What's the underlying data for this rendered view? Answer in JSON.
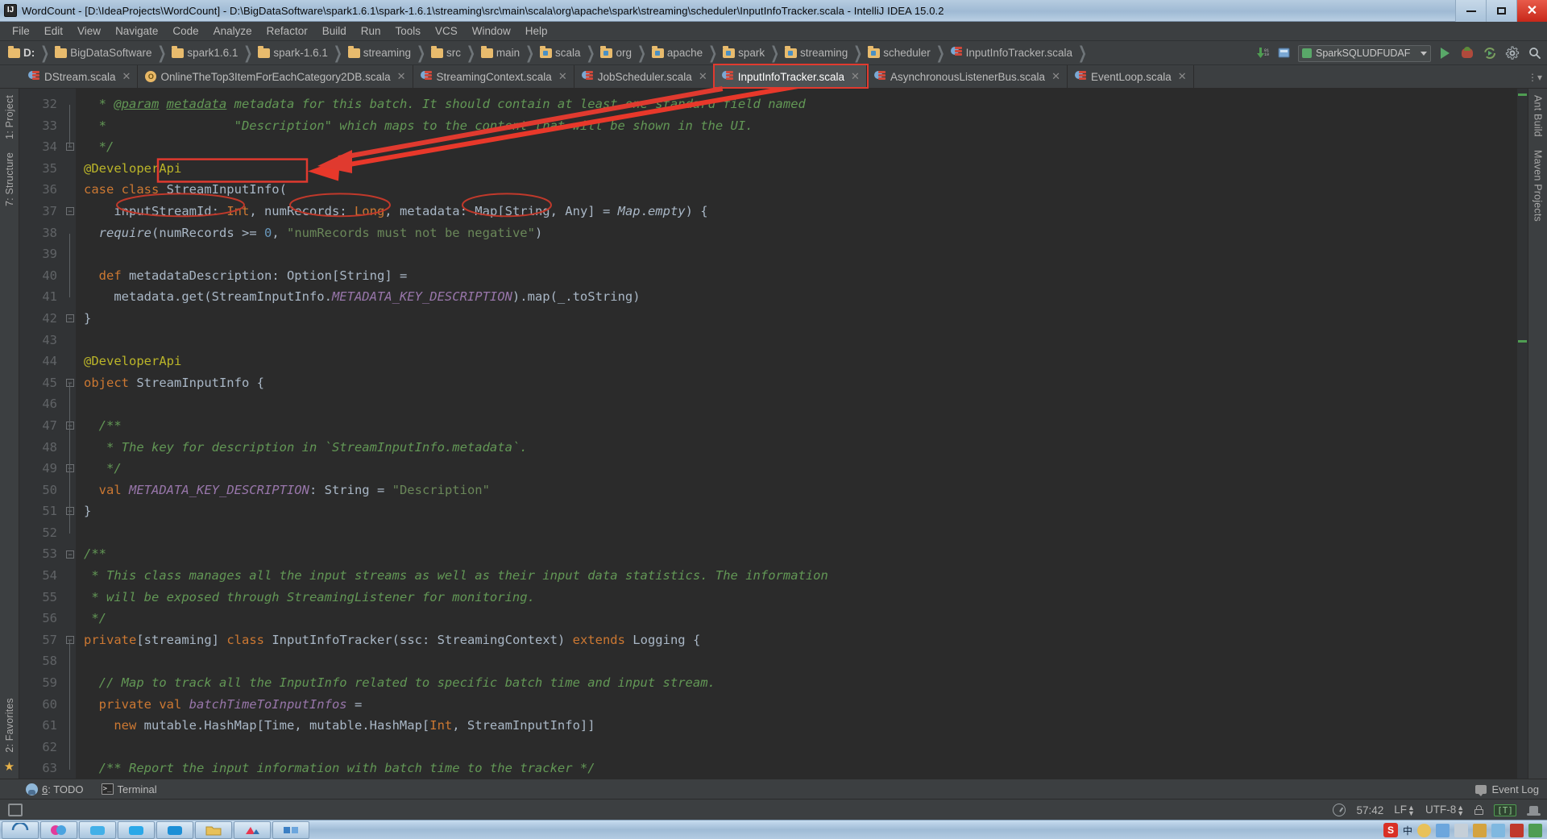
{
  "window": {
    "title": "WordCount - [D:\\IdeaProjects\\WordCount] - D:\\BigDataSoftware\\spark1.6.1\\spark-1.6.1\\streaming\\src\\main\\scala\\org\\apache\\spark\\streaming\\scheduler\\InputInfoTracker.scala - IntelliJ IDEA 15.0.2",
    "app_icon": "IJ",
    "minimize": "minimize-icon",
    "maximize": "maximize-icon",
    "close": "close-icon"
  },
  "menu": {
    "items": [
      "File",
      "Edit",
      "View",
      "Navigate",
      "Code",
      "Analyze",
      "Refactor",
      "Build",
      "Run",
      "Tools",
      "VCS",
      "Window",
      "Help"
    ]
  },
  "breadcrumb": {
    "items": [
      {
        "label": "D:",
        "icon": "folder-icon",
        "bold": true
      },
      {
        "label": "BigDataSoftware",
        "icon": "folder-icon",
        "bold": false
      },
      {
        "label": "spark1.6.1",
        "icon": "folder-icon",
        "bold": false
      },
      {
        "label": "spark-1.6.1",
        "icon": "folder-icon",
        "bold": false
      },
      {
        "label": "streaming",
        "icon": "folder-icon",
        "bold": false
      },
      {
        "label": "src",
        "icon": "folder-icon",
        "bold": false
      },
      {
        "label": "main",
        "icon": "folder-icon",
        "bold": false
      },
      {
        "label": "scala",
        "icon": "source-folder-icon",
        "bold": false
      },
      {
        "label": "org",
        "icon": "source-folder-icon",
        "bold": false
      },
      {
        "label": "apache",
        "icon": "source-folder-icon",
        "bold": false
      },
      {
        "label": "spark",
        "icon": "source-folder-icon",
        "bold": false
      },
      {
        "label": "streaming",
        "icon": "source-folder-icon",
        "bold": false
      },
      {
        "label": "scheduler",
        "icon": "source-folder-icon",
        "bold": false
      },
      {
        "label": "InputInfoTracker.scala",
        "icon": "scala-file-icon",
        "bold": false
      }
    ]
  },
  "toolbar": {
    "update_project_label": "update-project-icon",
    "compile_label": "compile-icon",
    "run_configuration": "SparkSQLUDFUDAF",
    "run_label": "run-icon",
    "debug_label": "debug-icon",
    "coverage_label": "run-with-coverage-icon",
    "settings_label": "settings-icon",
    "search_label": "search-everywhere-icon"
  },
  "tabs": [
    {
      "label": "DStream.scala",
      "icon": "scala-class-icon",
      "active": false,
      "closable": true
    },
    {
      "label": "OnlineTheTop3ItemForEachCategory2DB.scala",
      "icon": "scala-object-icon",
      "active": false,
      "closable": true
    },
    {
      "label": "StreamingContext.scala",
      "icon": "scala-class-icon",
      "active": false,
      "closable": true
    },
    {
      "label": "JobScheduler.scala",
      "icon": "scala-class-icon",
      "active": false,
      "closable": true
    },
    {
      "label": "InputInfoTracker.scala",
      "icon": "scala-class-icon",
      "active": true,
      "closable": true
    },
    {
      "label": "AsynchronousListenerBus.scala",
      "icon": "scala-class-icon",
      "active": false,
      "closable": true
    },
    {
      "label": "EventLoop.scala",
      "icon": "scala-class-icon",
      "active": false,
      "closable": true
    }
  ],
  "left_stripe": {
    "items": [
      "1: Project",
      "7: Structure",
      "2: Favorites"
    ]
  },
  "right_stripe": {
    "items": [
      "Ant Build",
      "Maven Projects"
    ]
  },
  "editor": {
    "first_line": 32,
    "lines": [
      {
        "n": 32,
        "tokens": [
          {
            "t": "  * ",
            "c": "cmt"
          },
          {
            "t": "@param",
            "c": "cmtp"
          },
          {
            "t": " ",
            "c": "cmt"
          },
          {
            "t": "metadata",
            "c": "cmtp"
          },
          {
            "t": " metadata for this batch. It should contain at least one standard field named",
            "c": "cmt"
          }
        ]
      },
      {
        "n": 33,
        "tokens": [
          {
            "t": "  *                 \"Description\" which maps to the content that will be shown in the UI.",
            "c": "cmt"
          }
        ]
      },
      {
        "n": 34,
        "tokens": [
          {
            "t": "  */",
            "c": "cmt"
          }
        ]
      },
      {
        "n": 35,
        "tokens": [
          {
            "t": "@DeveloperApi",
            "c": "ann"
          }
        ]
      },
      {
        "n": 36,
        "tokens": [
          {
            "t": "case class ",
            "c": "kw"
          },
          {
            "t": "StreamInputInfo",
            "c": "cls"
          },
          {
            "t": "(",
            "c": "typ"
          }
        ]
      },
      {
        "n": 37,
        "tokens": [
          {
            "t": "    inputStreamId",
            "c": "typ"
          },
          {
            "t": ": ",
            "c": "typ"
          },
          {
            "t": "Int",
            "c": "kw"
          },
          {
            "t": ", numRecords: ",
            "c": "typ"
          },
          {
            "t": "Long",
            "c": "kw"
          },
          {
            "t": ", metadata: ",
            "c": "typ"
          },
          {
            "t": "Map",
            "c": "typ"
          },
          {
            "t": "[",
            "c": "typ"
          },
          {
            "t": "String",
            "c": "typ"
          },
          {
            "t": ", ",
            "c": "typ"
          },
          {
            "t": "Any",
            "c": "typ"
          },
          {
            "t": "] = ",
            "c": "typ"
          },
          {
            "t": "Map",
            "c": "itl"
          },
          {
            "t": ".",
            "c": "typ"
          },
          {
            "t": "empty",
            "c": "itl"
          },
          {
            "t": ") {",
            "c": "typ"
          }
        ]
      },
      {
        "n": 38,
        "tokens": [
          {
            "t": "  ",
            "c": "typ"
          },
          {
            "t": "require",
            "c": "itl"
          },
          {
            "t": "(numRecords >= ",
            "c": "typ"
          },
          {
            "t": "0",
            "c": "num"
          },
          {
            "t": ", ",
            "c": "typ"
          },
          {
            "t": "\"numRecords must not be negative\"",
            "c": "str"
          },
          {
            "t": ")",
            "c": "typ"
          }
        ]
      },
      {
        "n": 39,
        "tokens": []
      },
      {
        "n": 40,
        "tokens": [
          {
            "t": "  ",
            "c": "typ"
          },
          {
            "t": "def ",
            "c": "kw"
          },
          {
            "t": "metadataDescription",
            "c": "typ"
          },
          {
            "t": ": Option[",
            "c": "typ"
          },
          {
            "t": "String",
            "c": "typ"
          },
          {
            "t": "] =",
            "c": "typ"
          }
        ]
      },
      {
        "n": 41,
        "tokens": [
          {
            "t": "    metadata.get(StreamInputInfo.",
            "c": "typ"
          },
          {
            "t": "METADATA_KEY_DESCRIPTION",
            "c": "fld"
          },
          {
            "t": ").map(_.toString)",
            "c": "typ"
          }
        ]
      },
      {
        "n": 42,
        "tokens": [
          {
            "t": "}",
            "c": "typ"
          }
        ]
      },
      {
        "n": 43,
        "tokens": []
      },
      {
        "n": 44,
        "tokens": [
          {
            "t": "@DeveloperApi",
            "c": "ann"
          }
        ]
      },
      {
        "n": 45,
        "tokens": [
          {
            "t": "object ",
            "c": "kw"
          },
          {
            "t": "StreamInputInfo",
            "c": "typ"
          },
          {
            "t": " {",
            "c": "typ"
          }
        ]
      },
      {
        "n": 46,
        "tokens": []
      },
      {
        "n": 47,
        "tokens": [
          {
            "t": "  /**",
            "c": "cmt"
          }
        ]
      },
      {
        "n": 48,
        "tokens": [
          {
            "t": "   * The key for description in `StreamInputInfo.metadata`.",
            "c": "cmt"
          }
        ]
      },
      {
        "n": 49,
        "tokens": [
          {
            "t": "   */",
            "c": "cmt"
          }
        ]
      },
      {
        "n": 50,
        "tokens": [
          {
            "t": "  ",
            "c": "typ"
          },
          {
            "t": "val ",
            "c": "kw"
          },
          {
            "t": "METADATA_KEY_DESCRIPTION",
            "c": "fld"
          },
          {
            "t": ": ",
            "c": "typ"
          },
          {
            "t": "String",
            "c": "typ"
          },
          {
            "t": " = ",
            "c": "typ"
          },
          {
            "t": "\"Description\"",
            "c": "str"
          }
        ]
      },
      {
        "n": 51,
        "tokens": [
          {
            "t": "}",
            "c": "typ"
          }
        ]
      },
      {
        "n": 52,
        "tokens": []
      },
      {
        "n": 53,
        "tokens": [
          {
            "t": "/**",
            "c": "cmt"
          }
        ]
      },
      {
        "n": 54,
        "tokens": [
          {
            "t": " * This class manages all the input streams as well as their input data statistics. The information",
            "c": "cmt"
          }
        ]
      },
      {
        "n": 55,
        "tokens": [
          {
            "t": " * will be exposed through StreamingListener for monitoring.",
            "c": "cmt"
          }
        ]
      },
      {
        "n": 56,
        "tokens": [
          {
            "t": " */",
            "c": "cmt"
          }
        ]
      },
      {
        "n": 57,
        "tokens": [
          {
            "t": "private",
            "c": "kw"
          },
          {
            "t": "[",
            "c": "typ"
          },
          {
            "t": "streaming",
            "c": "typ"
          },
          {
            "t": "] ",
            "c": "typ"
          },
          {
            "t": "class ",
            "c": "kw"
          },
          {
            "t": "InputInfoTracker",
            "c": "typ"
          },
          {
            "t": "(ssc: ",
            "c": "typ"
          },
          {
            "t": "StreamingContext",
            "c": "typ"
          },
          {
            "t": ") ",
            "c": "typ"
          },
          {
            "t": "extends ",
            "c": "kw"
          },
          {
            "t": "Logging",
            "c": "typ"
          },
          {
            "t": " {",
            "c": "typ"
          }
        ]
      },
      {
        "n": 58,
        "tokens": []
      },
      {
        "n": 59,
        "tokens": [
          {
            "t": "  // Map to track all the InputInfo related to specific batch time and input stream.",
            "c": "cmt"
          }
        ]
      },
      {
        "n": 60,
        "tokens": [
          {
            "t": "  ",
            "c": "typ"
          },
          {
            "t": "private ",
            "c": "kw"
          },
          {
            "t": "val ",
            "c": "kw"
          },
          {
            "t": "batchTimeToInputInfos",
            "c": "fld"
          },
          {
            "t": " =",
            "c": "typ"
          }
        ]
      },
      {
        "n": 61,
        "tokens": [
          {
            "t": "    ",
            "c": "typ"
          },
          {
            "t": "new ",
            "c": "kw"
          },
          {
            "t": "mutable.HashMap[Time, mutable.HashMap[",
            "c": "typ"
          },
          {
            "t": "Int",
            "c": "kw"
          },
          {
            "t": ", StreamInputInfo]]",
            "c": "typ"
          }
        ]
      },
      {
        "n": 62,
        "tokens": []
      },
      {
        "n": 63,
        "tokens": [
          {
            "t": "  /** Report the input information with batch time to the tracker */",
            "c": "cmt"
          }
        ]
      }
    ],
    "annotations": [
      {
        "type": "box",
        "target": "StreamInputInfo",
        "color": "#e03a2f"
      },
      {
        "type": "ellipse",
        "target": "inputStreamId",
        "color": "#e03a2f"
      },
      {
        "type": "ellipse",
        "target": "numRecords",
        "color": "#e03a2f"
      },
      {
        "type": "ellipse",
        "target": "metadata:",
        "color": "#e03a2f"
      },
      {
        "type": "box",
        "target": "InputInfoTracker.scala tab",
        "color": "#e03a2f"
      },
      {
        "type": "arrow",
        "from": "InputInfoTracker.scala tab",
        "to": "StreamInputInfo",
        "color": "#e03a2f"
      }
    ]
  },
  "bottom_tool_windows": {
    "todo": {
      "number": "6",
      "label": ": TODO"
    },
    "terminal": {
      "label": "Terminal"
    },
    "event_log": {
      "label": "Event Log"
    }
  },
  "status_bar": {
    "caret_position": "57:42",
    "line_separator": "LF",
    "encoding": "UTF-8",
    "lock_state": "unlocked-icon",
    "tab_badge": "[T]",
    "hat_icon": "hector-icon"
  },
  "taskbar": {
    "ime": "中",
    "tray_time": ""
  },
  "colors": {
    "accent": "#4b6eaf",
    "annotation": "#e03a2f",
    "editor_bg": "#2b2b2b",
    "chrome_bg": "#3c3f41"
  }
}
